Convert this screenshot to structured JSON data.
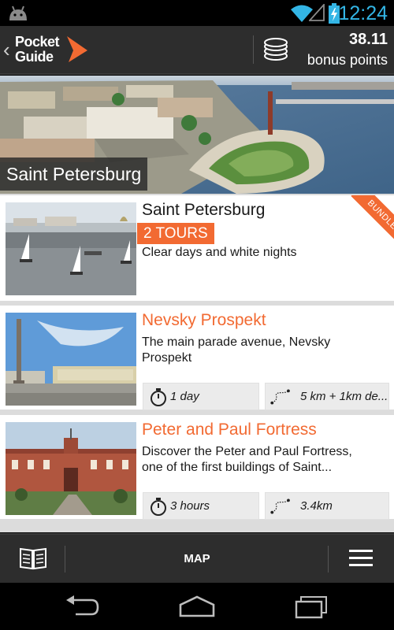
{
  "status_bar": {
    "time": "12:24",
    "icons": [
      "android-icon",
      "wifi-icon",
      "signal-icon",
      "battery-charging-icon"
    ]
  },
  "header": {
    "logo_text": "Pocket Guide",
    "logo_line1": "Pocket",
    "logo_line2": "Guide",
    "points_value": "38.11",
    "points_label": "bonus points",
    "icons": [
      "back-chevron-icon",
      "coins-icon"
    ]
  },
  "hero": {
    "city": "Saint Petersburg"
  },
  "tours": [
    {
      "title": "Saint Petersburg",
      "badge": "2 TOURS",
      "ribbon": "BUNDLE",
      "description": "Clear days and white nights"
    },
    {
      "title": "Nevsky Prospekt",
      "description_line1": "The main parade avenue, Nevsky",
      "description_line2": "Prospekt",
      "duration": "1 day",
      "distance": "5 km + 1km de..."
    },
    {
      "title": "Peter and Paul Fortress",
      "description_line1": "Discover the Peter and Paul Fortress,",
      "description_line2": "one of the first buildings of Saint...",
      "duration": "3 hours",
      "distance": "3.4km"
    }
  ],
  "bottom_bar": {
    "map_label": "MAP",
    "icons": [
      "book-icon",
      "menu-icon"
    ]
  },
  "nav_bar": {
    "icons": [
      "nav-back-icon",
      "nav-home-icon",
      "nav-recent-apps-icon"
    ]
  },
  "colors": {
    "accent": "#f26a32",
    "bar_background": "#2d2d2d",
    "status_clock": "#33b5e5",
    "list_background": "#dcdcdc"
  }
}
